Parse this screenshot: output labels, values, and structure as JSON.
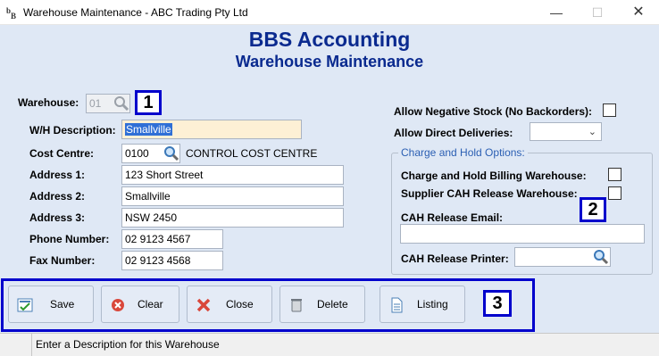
{
  "window": {
    "title": "Warehouse Maintenance - ABC Trading Pty Ltd",
    "min_glyph": "—",
    "max_glyph": "☐",
    "close_glyph": "✕"
  },
  "header": {
    "title": "BBS Accounting",
    "subtitle": "Warehouse Maintenance"
  },
  "form": {
    "warehouse": {
      "label": "Warehouse:",
      "value": "01"
    },
    "description": {
      "label": "W/H Description:",
      "value": "Smallville"
    },
    "cost_centre": {
      "label": "Cost Centre:",
      "value": "0100",
      "name": "CONTROL COST CENTRE"
    },
    "address1": {
      "label": "Address 1:",
      "value": "123 Short Street"
    },
    "address2": {
      "label": "Address 2:",
      "value": "Smallville"
    },
    "address3": {
      "label": "Address 3:",
      "value": "NSW 2450"
    },
    "phone": {
      "label": "Phone Number:",
      "value": "02 9123 4567"
    },
    "fax": {
      "label": "Fax Number:",
      "value": "02 9123 4568"
    }
  },
  "options": {
    "allow_negative": {
      "label": "Allow Negative Stock (No Backorders):",
      "checked": false
    },
    "allow_direct": {
      "label": "Allow Direct Deliveries:",
      "value": ""
    }
  },
  "charge_hold": {
    "group_title": "Charge and Hold Options:",
    "billing_warehouse": {
      "label": "Charge and Hold Billing Warehouse:",
      "checked": false
    },
    "supplier_release": {
      "label": "Supplier CAH Release Warehouse:",
      "checked": false
    },
    "release_email": {
      "label": "CAH Release Email:",
      "value": ""
    },
    "release_printer": {
      "label": "CAH Release Printer:",
      "value": ""
    }
  },
  "callouts": [
    "1",
    "2",
    "3"
  ],
  "toolbar": {
    "buttons": [
      {
        "label": "Save",
        "icon": "save-icon"
      },
      {
        "label": "Clear",
        "icon": "clear-icon"
      },
      {
        "label": "Close",
        "icon": "close-icon"
      },
      {
        "label": "Delete",
        "icon": "delete-icon"
      },
      {
        "label": "Listing",
        "icon": "listing-icon"
      }
    ]
  },
  "status": {
    "message": "Enter a Description for this Warehouse"
  },
  "colors": {
    "heading": "#0a2a8f",
    "callout_border": "#0000cc",
    "background": "#dfe8f5"
  }
}
